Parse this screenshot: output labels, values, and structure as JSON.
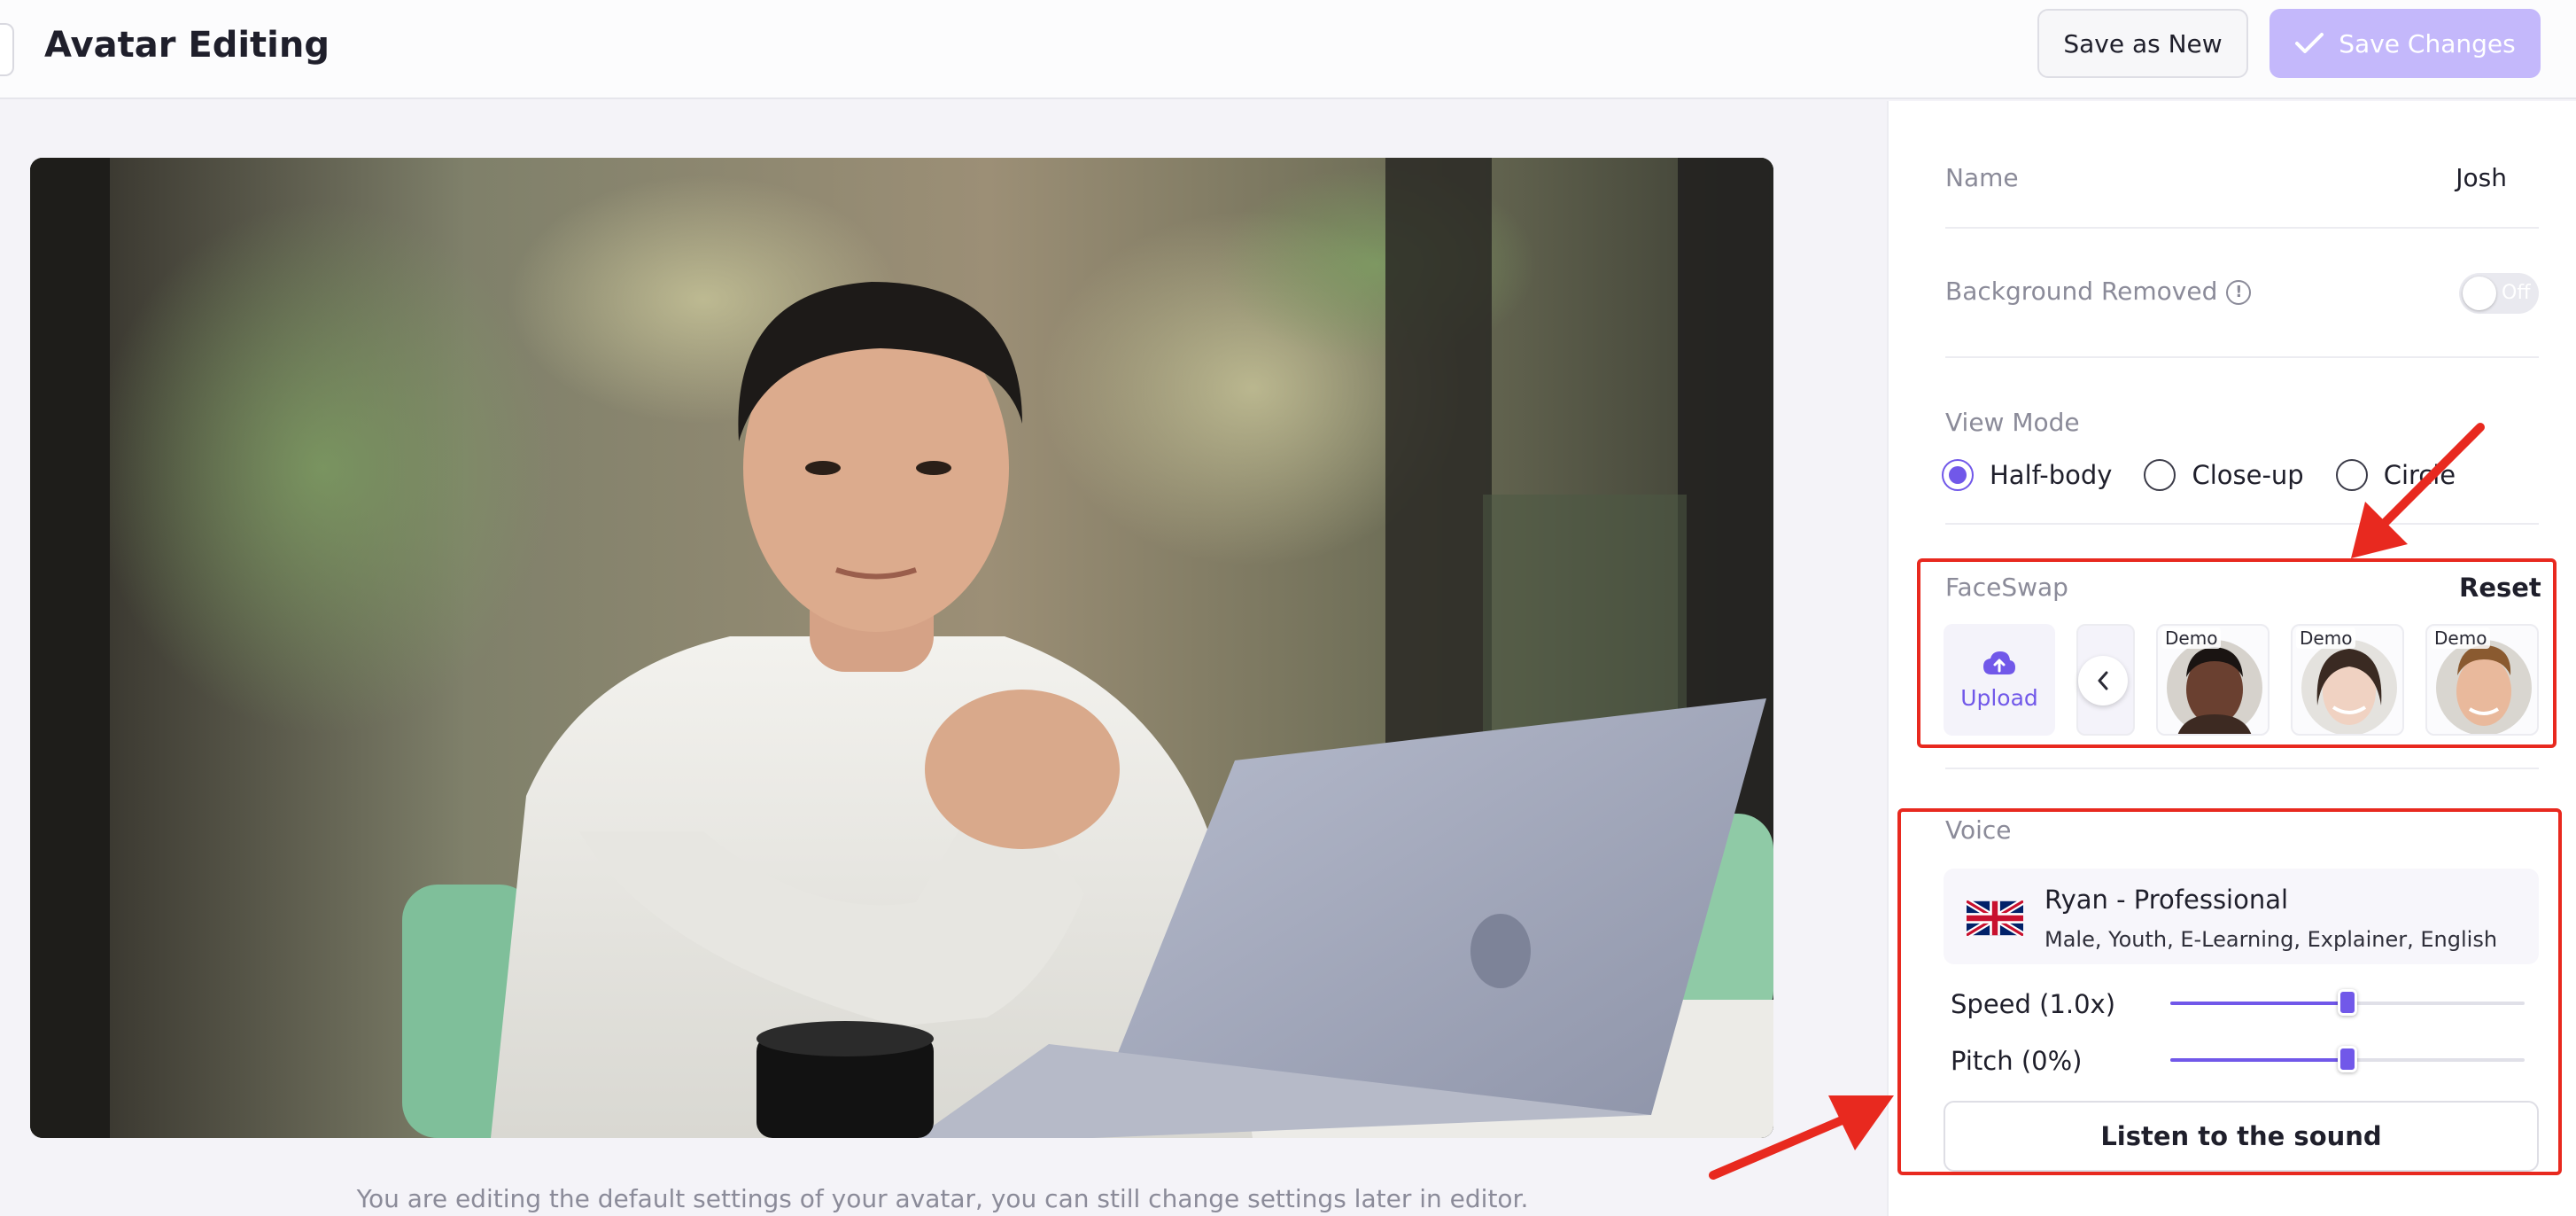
{
  "header": {
    "title": "Avatar Editing",
    "save_as_new_label": "Save as New",
    "save_changes_label": "Save Changes"
  },
  "main": {
    "caption": "You are editing the default settings of your avatar, you can still change settings later in editor."
  },
  "panel": {
    "name_label": "Name",
    "name_value": "Josh",
    "background_removed_label": "Background Removed",
    "background_removed_toggle": "Off",
    "view_mode_label": "View Mode",
    "view_modes": [
      {
        "label": "Half-body",
        "checked": true
      },
      {
        "label": "Close-up",
        "checked": false
      },
      {
        "label": "Circle",
        "checked": false
      }
    ],
    "faceswap_label": "FaceSwap",
    "faceswap_reset": "Reset",
    "upload_label": "Upload",
    "faces": [
      {
        "tag": "Demo"
      },
      {
        "tag": "Demo"
      },
      {
        "tag": "Demo"
      }
    ],
    "voice_label": "Voice",
    "voice_name": "Ryan - Professional",
    "voice_desc": "Male, Youth, E-Learning, Explainer, English",
    "speed_label": "Speed (1.0x)",
    "speed_fraction": 0.5,
    "pitch_label": "Pitch (0%)",
    "pitch_fraction": 0.5,
    "listen_label": "Listen to the sound"
  },
  "colors": {
    "accent": "#7158e9",
    "accent_disabled": "#c4b8fb",
    "annotation_red": "#e8291f"
  }
}
